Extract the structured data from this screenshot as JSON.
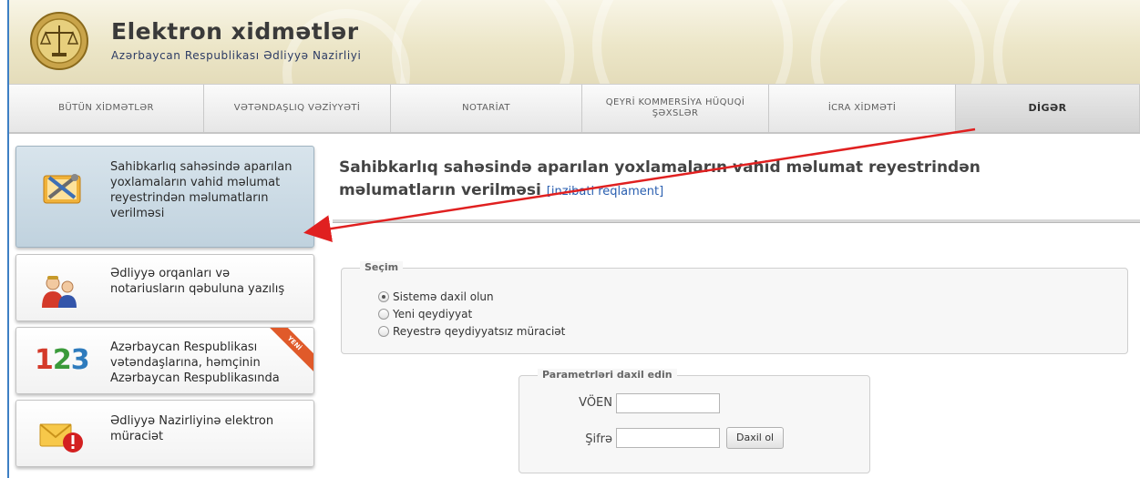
{
  "header": {
    "title": "Elektron xidmətlər",
    "subtitle": "Azərbaycan Respublikası Ədliyyə Nazirliyi"
  },
  "tabs": [
    {
      "label": "BÜTÜN XİDMƏTLƏR"
    },
    {
      "label": "VƏTƏNDAŞLIQ VƏZİYYƏTİ"
    },
    {
      "label": "NOTARİAT"
    },
    {
      "label": "QEYRİ KOMMERSİYA HÜQUQİ ŞƏXSLƏR"
    },
    {
      "label": "İCRA XİDMƏTİ"
    },
    {
      "label": "DİGƏR"
    }
  ],
  "sidebar": {
    "items": [
      {
        "label": "Sahibkarlıq sahəsində aparılan yoxlamaların vahid məlumat reyestrindən məlumatların verilməsi",
        "icon": "tools-icon"
      },
      {
        "label": "Ədliyyə orqanları və notariusların qəbuluna yazılış",
        "icon": "people-icon"
      },
      {
        "label": "Azərbaycan Respublikası vətəndaşlarına, həmçinin Azərbaycan Respublikasında",
        "icon": "numbers-icon",
        "badge": "YENİ",
        "icon_text": "123"
      },
      {
        "label": "Ədliyyə Nazirliyinə elektron müraciət",
        "icon": "envelope-alert-icon"
      }
    ]
  },
  "main": {
    "title": "Sahibkarlıq sahəsində aparılan yoxlamaların vahid məlumat reyestrindən məlumatların verilməsi",
    "regulation_link": "[inzibati reqlament]",
    "selection": {
      "legend": "Seçim",
      "options": [
        {
          "label": "Sistemə daxil olun",
          "checked": true
        },
        {
          "label": "Yeni qeydiyyat",
          "checked": false
        },
        {
          "label": "Reyestrə qeydiyyatsız müraciət",
          "checked": false
        }
      ]
    },
    "login": {
      "legend": "Parametrləri daxil edin",
      "voen_label": "VÖEN",
      "voen_value": "",
      "password_label": "Şifrə",
      "password_value": "",
      "submit_label": "Daxil ol"
    }
  },
  "colors": {
    "frame": "#3d7fc4",
    "annotation_arrow": "#e02020",
    "link": "#2a5fb0",
    "ribbon": "#e05a2a"
  }
}
